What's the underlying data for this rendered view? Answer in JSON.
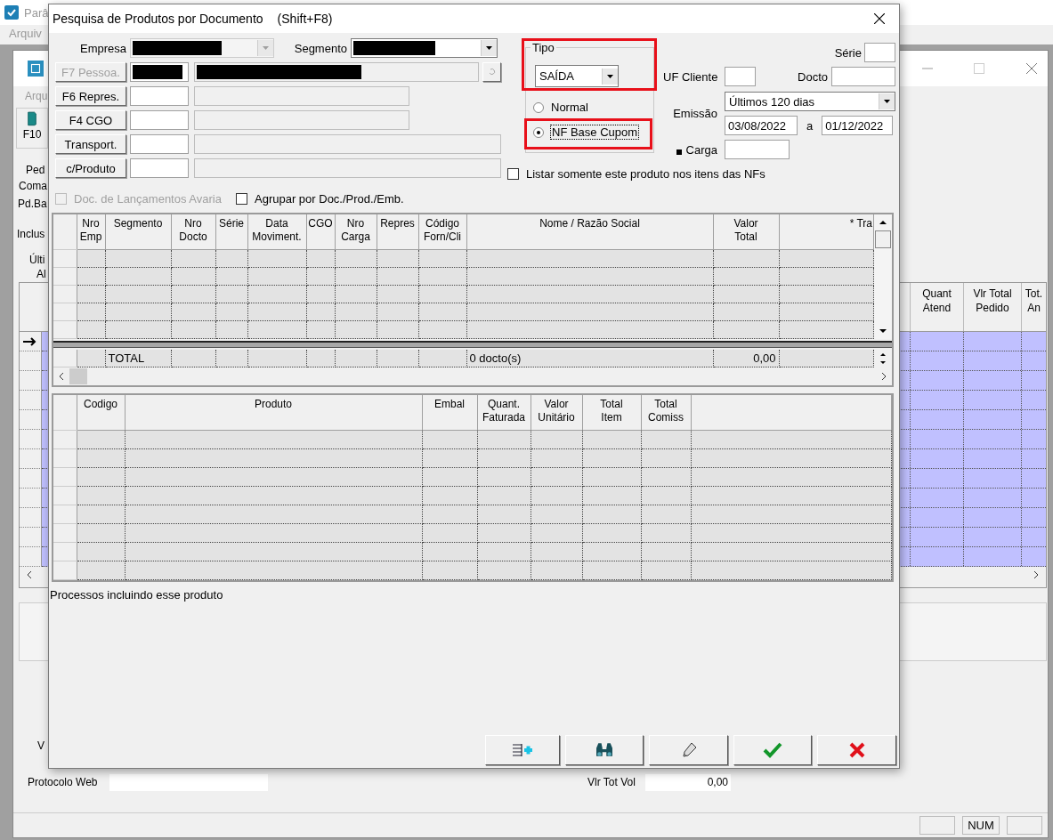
{
  "background_app": {
    "title": "Parâ",
    "menu": [
      "Arquiv"
    ]
  },
  "background_window": {
    "menu": [
      "Arqu"
    ],
    "toolbar": [
      {
        "label": "F10"
      }
    ],
    "side_labels": [
      "Ped",
      "Coma",
      "Pd.Ba",
      "Inclus",
      "Últi",
      "Al"
    ],
    "grid": {
      "columns": [
        "Quant\nAtend",
        "Vlr Total\nPedido",
        "Tot.\nAn"
      ],
      "rows": [
        {
          "current": true
        },
        {
          "current": false
        },
        {
          "current": false
        },
        {
          "current": false
        },
        {
          "current": false
        },
        {
          "current": false
        },
        {
          "current": false
        },
        {
          "current": false
        },
        {
          "current": false
        },
        {
          "current": false
        },
        {
          "current": false
        },
        {
          "current": false
        }
      ]
    },
    "cut_label": "V",
    "protocolo": {
      "label": "Protocolo Web"
    },
    "vlr_tot_vol": {
      "label": "Vlr Tot Vol",
      "value": "0,00"
    },
    "status_bar": {
      "indicator": "NUM"
    }
  },
  "dialog": {
    "title": "Pesquisa de Produtos por Documento",
    "shortcut": "(Shift+F8)",
    "empresa": {
      "label": "Empresa",
      "disabled": true,
      "redacted": true
    },
    "segmento": {
      "label": "Segmento",
      "disabled": false,
      "redacted": true
    },
    "lookups": [
      {
        "kind": "person",
        "button": "F7 Pessoa.",
        "disabled": true,
        "redacted": true
      },
      {
        "kind": "short",
        "button": "F6 Repres.",
        "disabled": false,
        "redacted": false
      },
      {
        "kind": "short",
        "button": "F4 CGO",
        "disabled": false,
        "redacted": false
      },
      {
        "kind": "long",
        "button": "Transport.",
        "disabled": false,
        "redacted": false
      },
      {
        "kind": "long",
        "button": "c/Produto",
        "disabled": false,
        "redacted": false
      }
    ],
    "tipo": {
      "label": "Tipo",
      "value": "SAÍDA",
      "options": [
        {
          "label": "Normal",
          "selected": false
        },
        {
          "label": "NF Base Cupom",
          "selected": true
        }
      ]
    },
    "serie": {
      "label": "Série"
    },
    "uf_cliente": {
      "label": "UF Cliente"
    },
    "docto": {
      "label": "Docto"
    },
    "emissao": {
      "label": "Emissão",
      "period": "Últimos 120 dias",
      "from": "03/08/2022",
      "to_label": "a",
      "to": "01/12/2022"
    },
    "carga": {
      "label": "Carga"
    },
    "listar": {
      "label": "Listar somente este produto nos itens das NFs",
      "checked": false,
      "disabled": false
    },
    "options": [
      {
        "label": "Doc. de Lançamentos Avaria",
        "checked": false,
        "disabled": true
      },
      {
        "label": "Agrupar por Doc./Prod./Emb.",
        "checked": false,
        "disabled": false
      }
    ],
    "documents_grid": {
      "columns": [
        "Nro\nEmp",
        "Segmento",
        "Nro\nDocto",
        "Série",
        "Data\nMoviment.",
        "CGO",
        "Nro\nCarga",
        "Repres",
        "Código\nForn/Cli",
        "Nome / Razão Social",
        "Valor\nTotal",
        "* Tra"
      ],
      "totals": {
        "label": "TOTAL",
        "count": "0 docto(s)",
        "value": "0,00"
      }
    },
    "items_grid": {
      "columns": [
        "Codigo",
        "Produto",
        "Embal",
        "Quant.\nFaturada",
        "Valor\nUnitário",
        "Total\nItem",
        "Total\nComiss"
      ]
    },
    "processes_label": "Processos incluindo esse produto",
    "buttons": [
      {
        "kind": "add"
      },
      {
        "kind": "search"
      },
      {
        "kind": "clear"
      },
      {
        "kind": "ok"
      },
      {
        "kind": "cancel"
      }
    ]
  }
}
